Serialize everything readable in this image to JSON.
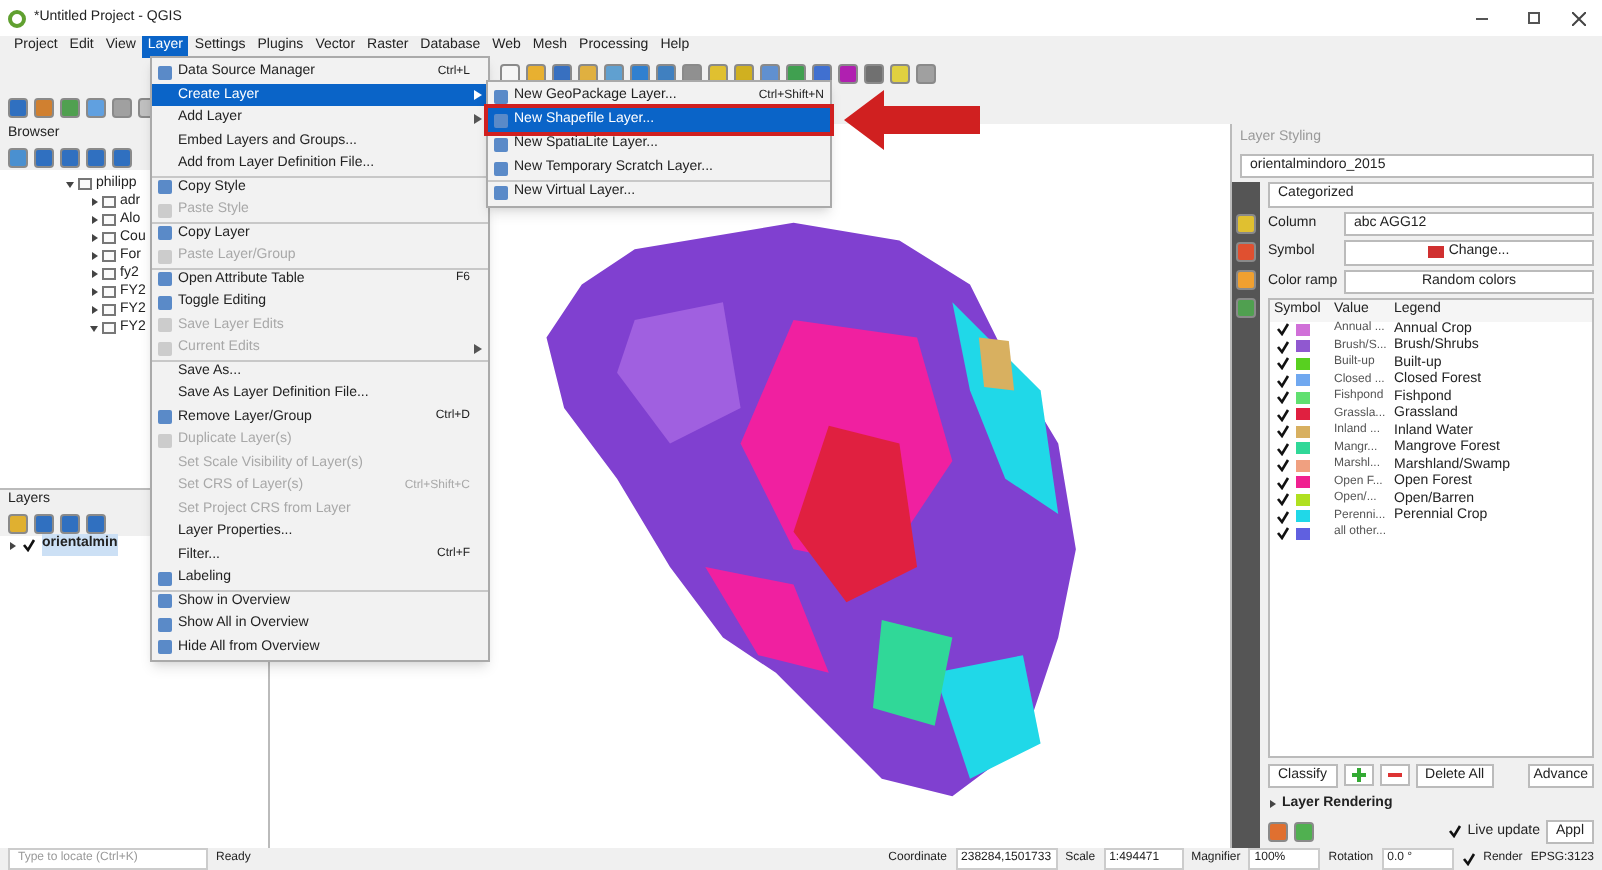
{
  "window": {
    "title": "*Untitled Project - QGIS"
  },
  "menubar": [
    {
      "label": "Project",
      "selected": false
    },
    {
      "label": "Edit",
      "selected": false
    },
    {
      "label": "View",
      "selected": false
    },
    {
      "label": "Layer",
      "selected": true
    },
    {
      "label": "Settings",
      "selected": false
    },
    {
      "label": "Plugins",
      "selected": false
    },
    {
      "label": "Vector",
      "selected": false
    },
    {
      "label": "Raster",
      "selected": false
    },
    {
      "label": "Database",
      "selected": false
    },
    {
      "label": "Web",
      "selected": false
    },
    {
      "label": "Mesh",
      "selected": false
    },
    {
      "label": "Processing",
      "selected": false
    },
    {
      "label": "Help",
      "selected": false
    }
  ],
  "browser": {
    "title": "Browser",
    "items": [
      {
        "label": "philipp",
        "expanded": true
      },
      {
        "label": "adr",
        "expanded": false
      },
      {
        "label": "Alo",
        "expanded": false
      },
      {
        "label": "Cou",
        "expanded": false
      },
      {
        "label": "For",
        "expanded": false
      },
      {
        "label": "fy2",
        "expanded": false
      },
      {
        "label": "FY2",
        "expanded": false
      },
      {
        "label": "FY2",
        "expanded": false
      },
      {
        "label": "FY2",
        "expanded": true
      }
    ]
  },
  "layers": {
    "title": "Layers",
    "items": [
      {
        "label": "orientalmin",
        "checked": true
      }
    ]
  },
  "layer_menu": [
    {
      "label": "Data Source Manager",
      "shortcut": "Ctrl+L",
      "disabled": false,
      "submenu": false,
      "selected": false,
      "separator_before": false,
      "icon": true
    },
    {
      "label": "Create Layer",
      "disabled": false,
      "submenu": true,
      "selected": true,
      "separator_before": false,
      "icon": false
    },
    {
      "label": "Add Layer",
      "disabled": false,
      "submenu": true,
      "selected": false,
      "separator_before": false,
      "icon": false
    },
    {
      "label": "Embed Layers and Groups...",
      "disabled": false,
      "submenu": false,
      "selected": false,
      "separator_before": false,
      "icon": false
    },
    {
      "label": "Add from Layer Definition File...",
      "disabled": false,
      "submenu": false,
      "selected": false,
      "separator_before": false,
      "icon": false
    },
    {
      "label": "Copy Style",
      "disabled": false,
      "submenu": false,
      "selected": false,
      "separator_before": true,
      "icon": true
    },
    {
      "label": "Paste Style",
      "disabled": true,
      "submenu": false,
      "selected": false,
      "separator_before": false,
      "icon": true
    },
    {
      "label": "Copy Layer",
      "disabled": false,
      "submenu": false,
      "selected": false,
      "separator_before": true,
      "icon": true
    },
    {
      "label": "Paste Layer/Group",
      "disabled": true,
      "submenu": false,
      "selected": false,
      "separator_before": false,
      "icon": true
    },
    {
      "label": "Open Attribute Table",
      "shortcut": "F6",
      "disabled": false,
      "submenu": false,
      "selected": false,
      "separator_before": true,
      "icon": true
    },
    {
      "label": "Toggle Editing",
      "disabled": false,
      "submenu": false,
      "selected": false,
      "separator_before": false,
      "icon": true
    },
    {
      "label": "Save Layer Edits",
      "disabled": true,
      "submenu": false,
      "selected": false,
      "separator_before": false,
      "icon": true
    },
    {
      "label": "Current Edits",
      "disabled": true,
      "submenu": true,
      "selected": false,
      "separator_before": false,
      "icon": true
    },
    {
      "label": "Save As...",
      "disabled": false,
      "submenu": false,
      "selected": false,
      "separator_before": true,
      "icon": false
    },
    {
      "label": "Save As Layer Definition File...",
      "disabled": false,
      "submenu": false,
      "selected": false,
      "separator_before": false,
      "icon": false
    },
    {
      "label": "Remove Layer/Group",
      "shortcut": "Ctrl+D",
      "disabled": false,
      "submenu": false,
      "selected": false,
      "separator_before": false,
      "icon": true
    },
    {
      "label": "Duplicate Layer(s)",
      "disabled": true,
      "submenu": false,
      "selected": false,
      "separator_before": false,
      "icon": true
    },
    {
      "label": "Set Scale Visibility of Layer(s)",
      "disabled": true,
      "submenu": false,
      "selected": false,
      "separator_before": false,
      "icon": false
    },
    {
      "label": "Set CRS of Layer(s)",
      "shortcut": "Ctrl+Shift+C",
      "disabled": true,
      "submenu": false,
      "selected": false,
      "separator_before": false,
      "icon": false
    },
    {
      "label": "Set Project CRS from Layer",
      "disabled": true,
      "submenu": false,
      "selected": false,
      "separator_before": false,
      "icon": false
    },
    {
      "label": "Layer Properties...",
      "disabled": false,
      "submenu": false,
      "selected": false,
      "separator_before": false,
      "icon": false
    },
    {
      "label": "Filter...",
      "shortcut": "Ctrl+F",
      "disabled": false,
      "submenu": false,
      "selected": false,
      "separator_before": false,
      "icon": false
    },
    {
      "label": "Labeling",
      "disabled": false,
      "submenu": false,
      "selected": false,
      "separator_before": false,
      "icon": true
    },
    {
      "label": "Show in Overview",
      "disabled": false,
      "submenu": false,
      "selected": false,
      "separator_before": true,
      "icon": true
    },
    {
      "label": "Show All in Overview",
      "disabled": false,
      "submenu": false,
      "selected": false,
      "separator_before": false,
      "icon": true
    },
    {
      "label": "Hide All from Overview",
      "disabled": false,
      "submenu": false,
      "selected": false,
      "separator_before": false,
      "icon": true
    }
  ],
  "create_layer_menu": [
    {
      "label": "New GeoPackage Layer...",
      "shortcut": "Ctrl+Shift+N",
      "selected": false,
      "separator_before": false
    },
    {
      "label": "New Shapefile Layer...",
      "selected": true,
      "separator_before": false
    },
    {
      "label": "New SpatiaLite Layer...",
      "selected": false,
      "separator_before": false
    },
    {
      "label": "New Temporary Scratch Layer...",
      "selected": false,
      "separator_before": false
    },
    {
      "label": "New Virtual Layer...",
      "selected": false,
      "separator_before": true
    }
  ],
  "layer_styling": {
    "title": "Layer Styling",
    "layer": "orientalmindoro_2015",
    "renderer": "Categorized",
    "column_label": "Column",
    "column_value": "abc AGG12",
    "symbol_label": "Symbol",
    "symbol_button": "Change...",
    "ramp_label": "Color ramp",
    "ramp_value": "Random colors",
    "columns": [
      "Symbol",
      "Value",
      "Legend"
    ],
    "rows": [
      {
        "value": "Annual ...",
        "legend": "Annual Crop",
        "color": "#d070d8",
        "checked": true
      },
      {
        "value": "Brush/S...",
        "legend": "Brush/Shrubs",
        "color": "#9058d0",
        "checked": true
      },
      {
        "value": "Built-up",
        "legend": "Built-up",
        "color": "#58d020",
        "checked": true
      },
      {
        "value": "Closed ...",
        "legend": "Closed Forest",
        "color": "#70a8f0",
        "checked": true
      },
      {
        "value": "Fishpond",
        "legend": "Fishpond",
        "color": "#60e070",
        "checked": true
      },
      {
        "value": "Grassla...",
        "legend": "Grassland",
        "color": "#e02040",
        "checked": true
      },
      {
        "value": "Inland ...",
        "legend": "Inland Water",
        "color": "#d8b060",
        "checked": true
      },
      {
        "value": "Mangr...",
        "legend": "Mangrove Forest",
        "color": "#30d898",
        "checked": true
      },
      {
        "value": "Marshl...",
        "legend": "Marshland/Swamp",
        "color": "#f0a080",
        "checked": true
      },
      {
        "value": "Open F...",
        "legend": "Open Forest",
        "color": "#f02090",
        "checked": true
      },
      {
        "value": "Open/...",
        "legend": "Open/Barren",
        "color": "#b0e020",
        "checked": true
      },
      {
        "value": "Perenni...",
        "legend": "Perennial Crop",
        "color": "#20d8e8",
        "checked": true
      },
      {
        "value": "all other...",
        "legend": "",
        "color": "#6060e0",
        "checked": true
      }
    ],
    "buttons": [
      "Classify",
      "Delete All",
      "Advance"
    ],
    "rendering": "Layer Rendering",
    "live_update": {
      "label": "Live update",
      "checked": true
    },
    "apply": "Appl"
  },
  "status_bar": {
    "locator_placeholder": "Type to locate (Ctrl+K)",
    "message": "Ready",
    "coordinate_label": "Coordinate",
    "coordinate": "238284,1501733",
    "scale_label": "Scale",
    "scale": "1:494471",
    "magnifier_label": "Magnifier",
    "magnifier": "100%",
    "rotation_label": "Rotation",
    "rotation": "0.0 °",
    "render": {
      "label": "Render",
      "checked": true
    },
    "crs": "EPSG:3123"
  }
}
